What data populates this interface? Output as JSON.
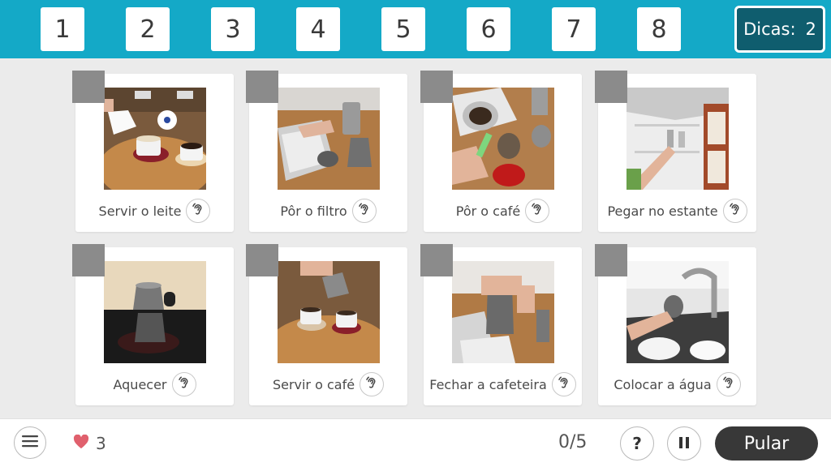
{
  "steps": [
    "1",
    "2",
    "3",
    "4",
    "5",
    "6",
    "7",
    "8"
  ],
  "hints": {
    "label": "Dicas:",
    "count": "2"
  },
  "cards": [
    {
      "label": "Servir o leite"
    },
    {
      "label": "Pôr o filtro"
    },
    {
      "label": "Pôr o café"
    },
    {
      "label": "Pegar no estante"
    },
    {
      "label": "Aquecer"
    },
    {
      "label": "Servir o café"
    },
    {
      "label": "Fechar a cafeteira"
    },
    {
      "label": "Colocar a água"
    }
  ],
  "footer": {
    "lives": "3",
    "progress": "0/5",
    "help_label": "?",
    "skip_label": "Pular"
  },
  "colors": {
    "topbar": "#14a9c7",
    "hints_bg": "#0f5d6e",
    "corner": "#8b8b8b",
    "heart": "#e0606d",
    "skip_bg": "#383838"
  },
  "icons": [
    "menu-icon",
    "heart-icon",
    "ear-icon",
    "pause-icon"
  ]
}
